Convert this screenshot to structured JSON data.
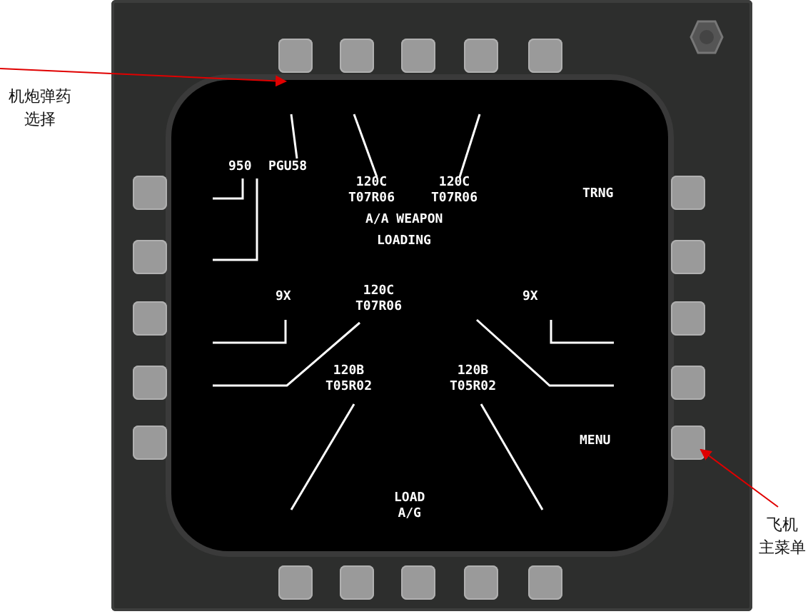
{
  "annotations": [
    {
      "lines": [
        "机炮弹药",
        "选择"
      ]
    },
    {
      "lines": [
        "飞机",
        "主菜单"
      ]
    }
  ],
  "display": {
    "labels": [
      {
        "lines": [
          "950"
        ]
      },
      {
        "lines": [
          "PGU58"
        ]
      },
      {
        "lines": [
          "120C",
          "T07R06"
        ]
      },
      {
        "lines": [
          "120C",
          "T07R06"
        ]
      },
      {
        "lines": [
          "TRNG"
        ]
      },
      {
        "lines": [
          "A/A WEAPON"
        ]
      },
      {
        "lines": [
          "LOADING"
        ]
      },
      {
        "lines": [
          "9X"
        ]
      },
      {
        "lines": [
          "120C",
          "T07R06"
        ]
      },
      {
        "lines": [
          "9X"
        ]
      },
      {
        "lines": [
          "120B",
          "T05R02"
        ]
      },
      {
        "lines": [
          "120B",
          "T05R02"
        ]
      },
      {
        "lines": [
          "MENU"
        ]
      },
      {
        "lines": [
          "LOAD",
          "A/G"
        ]
      }
    ]
  }
}
